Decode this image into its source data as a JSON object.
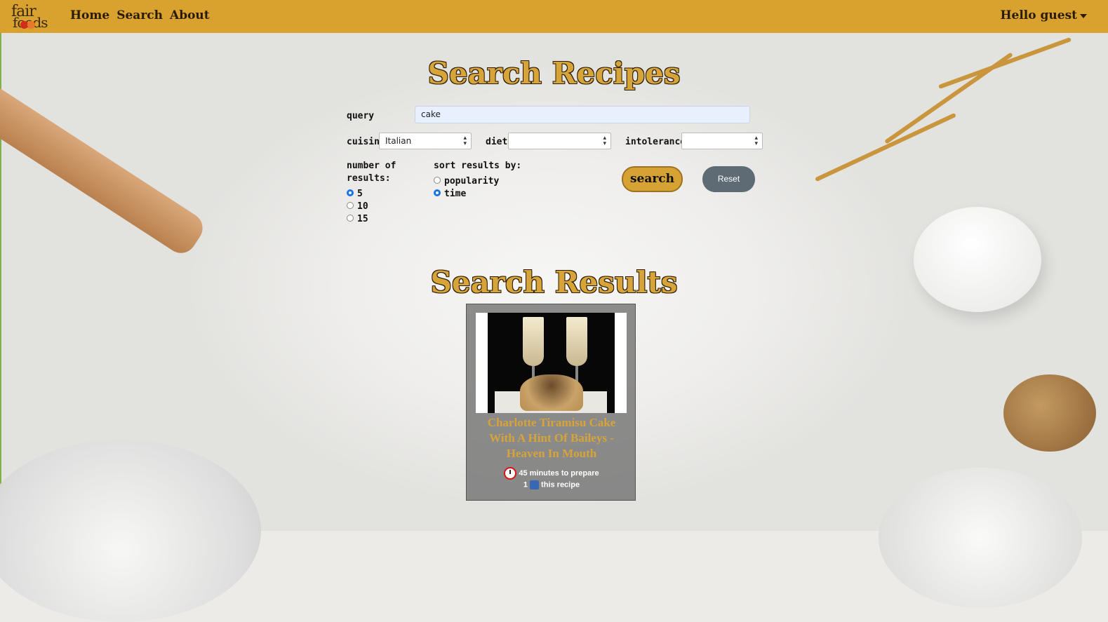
{
  "navbar": {
    "logo_top": "fair",
    "logo_bottom": "foods",
    "links": [
      "Home",
      "Search",
      "About"
    ],
    "user_menu": "Hello guest"
  },
  "search": {
    "title": "Search Recipes",
    "query_label": "query",
    "query_value": "cake",
    "cuisine_label": "cuisine",
    "cuisine_value": "Italian",
    "diet_label": "diet",
    "diet_value": "",
    "intolerance_label": "intolerance",
    "intolerance_value": "",
    "number_label_line1": "number of",
    "number_label_line2": "results:",
    "number_options": [
      "5",
      "10",
      "15"
    ],
    "number_selected": "5",
    "sort_label": "sort results by:",
    "sort_options": [
      "popularity",
      "time"
    ],
    "sort_selected": "time",
    "search_button": "search",
    "reset_button": "Reset"
  },
  "results": {
    "title": "Search Results",
    "items": [
      {
        "title": "Charlotte Tiramisu Cake With A Hint Of Baileys - Heaven In Mouth",
        "time_text": "45 minutes to prepare",
        "likes_count": "1",
        "likes_text": "this recipe"
      }
    ]
  },
  "colors": {
    "navbar": "#d9a22e",
    "accent_gold": "#d7a43a",
    "reset_gray": "#5f6b74",
    "radio_blue": "#1a73e8"
  }
}
